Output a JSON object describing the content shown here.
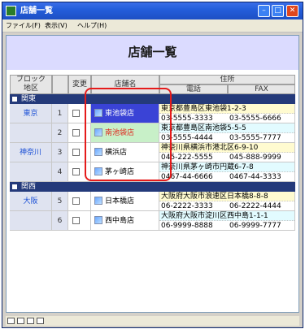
{
  "window": {
    "title": "店舗一覧"
  },
  "menu": [
    "ファイル(F)",
    "表示(V)",
    "ヘルプ(H)"
  ],
  "header": {
    "title": "店舗一覧"
  },
  "columns": {
    "block": "ブロック",
    "area": "地区",
    "change": "変更",
    "store": "店舗名",
    "address": "住所",
    "tel": "電話",
    "fax": "FAX"
  },
  "groups": [
    {
      "label": "関東",
      "rows": [
        {
          "region": "東京",
          "num": "1",
          "store": "東池袋店",
          "store_color": "#ffffff",
          "store_bg": "#3a43d6",
          "addr": "東京都豊島区東池袋1-2-3",
          "tel": "03-5555-3333",
          "fax": "03-5555-6666",
          "addr_style": "yellow"
        },
        {
          "region": "",
          "num": "2",
          "store": "南池袋店",
          "store_color": "#e0261d",
          "store_bg": "#c8f0c8",
          "addr": "東京都豊島区南池袋5-5-5",
          "tel": "03-5555-4444",
          "fax": "03-5555-7777",
          "addr_style": "cyan"
        },
        {
          "region": "神奈川",
          "num": "3",
          "store": "横浜店",
          "store_color": "#000000",
          "store_bg": "#ffffff",
          "addr": "神奈川県横浜市港北区6-9-10",
          "tel": "045-222-5555",
          "fax": "045-888-9999",
          "addr_style": "yellow"
        },
        {
          "region": "",
          "num": "4",
          "store": "茅ヶ崎店",
          "store_color": "#000000",
          "store_bg": "#ffffff",
          "addr": "神奈川県茅ヶ崎市円蔵6-7-8",
          "tel": "0467-44-6666",
          "fax": "0467-44-3333",
          "addr_style": "cyan"
        }
      ]
    },
    {
      "label": "関西",
      "rows": [
        {
          "region": "大阪",
          "num": "5",
          "store": "日本橋店",
          "store_color": "#000000",
          "store_bg": "#ffffff",
          "addr": "大阪府大阪市浪速区日本橋8-8-8",
          "tel": "06-2222-3333",
          "fax": "06-2222-4444",
          "addr_style": "yellow"
        },
        {
          "region": "",
          "num": "6",
          "store": "西中島店",
          "store_color": "#000000",
          "store_bg": "#ffffff",
          "addr": "大阪府大阪市淀川区西中島1-1-1",
          "tel": "06-9999-8888",
          "fax": "06-9999-7777",
          "addr_style": "cyan"
        }
      ]
    }
  ],
  "status_icons": [
    "doc-icon",
    "grid-icon",
    "print-icon",
    "link-icon"
  ]
}
